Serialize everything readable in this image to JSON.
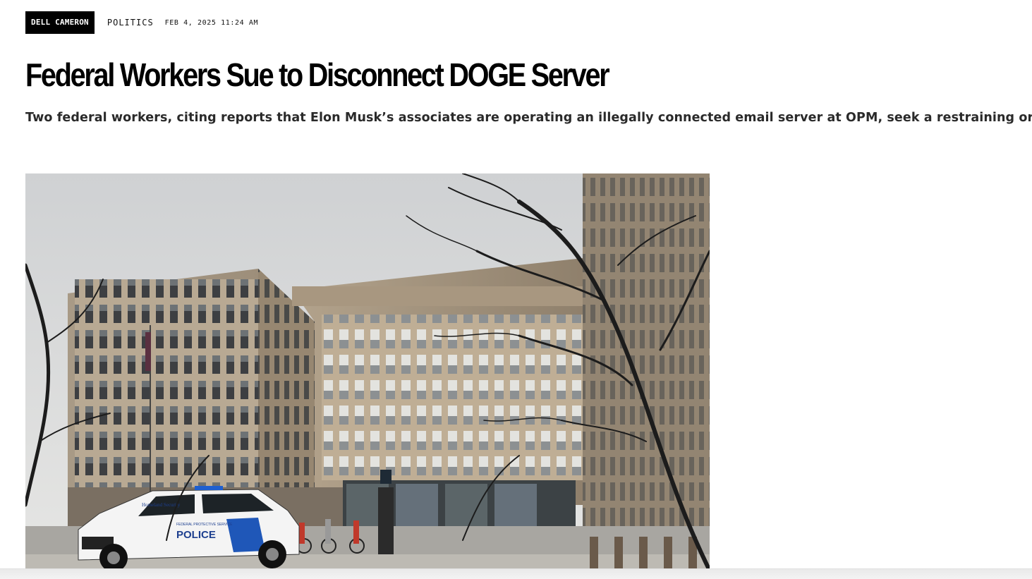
{
  "article": {
    "author": "DELL CAMERON",
    "category": "POLITICS",
    "timestamp": "FEB 4, 2025 11:24 AM",
    "headline": "Federal Workers Sue to Disconnect DOGE Server",
    "dek": "Two federal workers, citing reports that Elon Musk’s associates are operating an illegally connected email server at OPM, seek a restraining order."
  },
  "hero_image": {
    "vehicle_marking": "POLICE",
    "vehicle_agency": "Homeland Security",
    "vehicle_division": "FEDERAL PROTECTIVE SERVICE"
  }
}
